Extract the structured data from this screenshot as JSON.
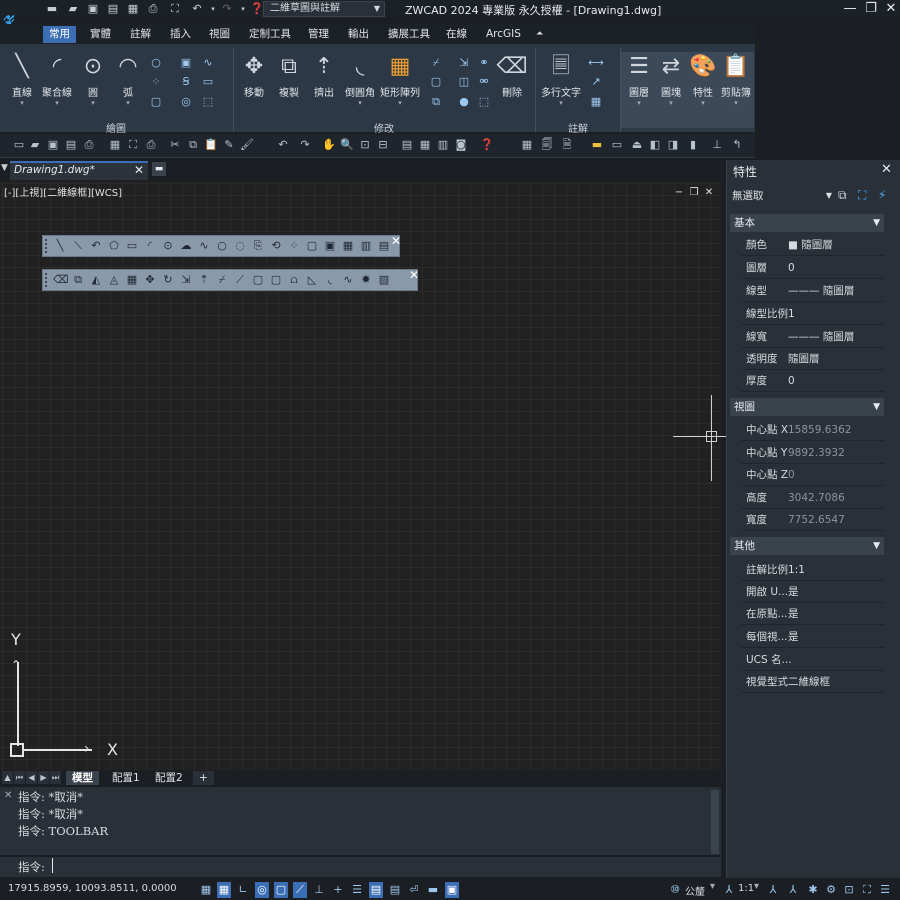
{
  "title_bar": {
    "workspace": "二維草圖與註解",
    "window_title": "ZWCAD 2024 專業版 永久授權 - [Drawing1.dwg]"
  },
  "ribbon_tabs": [
    "常用",
    "實體",
    "註解",
    "插入",
    "視圖",
    "定制工具",
    "管理",
    "輸出",
    "擴展工具",
    "在線",
    "ArcGIS"
  ],
  "ribbon": {
    "draw": {
      "title": "繪圖",
      "line": "直線",
      "polyline": "聚合線",
      "circle": "圓",
      "arc": "弧"
    },
    "modify": {
      "title": "修改",
      "move": "移動",
      "copy": "複製",
      "extrude": "擠出",
      "fillet": "倒圓角",
      "array": "矩形陣列",
      "erase": "刪除"
    },
    "annotation": {
      "title": "註解",
      "mtext": "多行文字"
    },
    "layers": "圖層",
    "blocks": "圖塊",
    "properties": "特性",
    "clipboard": "剪貼簿"
  },
  "document": {
    "tab_name": "Drawing1.dwg*"
  },
  "viewport": {
    "label": "[-][上視][二維線框][WCS]",
    "ucs_x": "X",
    "ucs_y": "Y"
  },
  "layout_tabs": [
    "模型",
    "配置1",
    "配置2",
    "+"
  ],
  "command": {
    "history": [
      "指令: *取消*",
      "指令: *取消*",
      "指令: TOOLBAR"
    ],
    "prompt": "指令:"
  },
  "status": {
    "coords": "17915.8959, 10093.8511, 0.0000",
    "units": "公釐",
    "scale": "1:1"
  },
  "properties": {
    "title": "特性",
    "selection": "無選取",
    "sections": [
      {
        "name": "基本",
        "rows": [
          {
            "key": "顏色",
            "value": "■ 隨圖層"
          },
          {
            "key": "圖層",
            "value": "0"
          },
          {
            "key": "線型",
            "value": "——— 隨圖層"
          },
          {
            "key": "線型比例",
            "value": "1"
          },
          {
            "key": "線寬",
            "value": "——— 隨圖層"
          },
          {
            "key": "透明度",
            "value": "隨圖層"
          },
          {
            "key": "厚度",
            "value": "0"
          }
        ]
      },
      {
        "name": "視圖",
        "rows": [
          {
            "key": "中心點 X",
            "value": "15859.6362"
          },
          {
            "key": "中心點 Y",
            "value": "9892.3932"
          },
          {
            "key": "中心點 Z",
            "value": "0"
          },
          {
            "key": "高度",
            "value": "3042.7086"
          },
          {
            "key": "寬度",
            "value": "7752.6547"
          }
        ]
      },
      {
        "name": "其他",
        "rows": [
          {
            "key": "註解比例",
            "value": "1:1"
          },
          {
            "key": "開啟 U...",
            "value": "是"
          },
          {
            "key": "在原點...",
            "value": "是"
          },
          {
            "key": "每個視...",
            "value": "是"
          },
          {
            "key": "UCS 名...",
            "value": ""
          },
          {
            "key": "視覺型式",
            "value": "二維線框"
          }
        ]
      }
    ]
  },
  "colors": {
    "accent": "#3b6eb4",
    "ribbon": "#2c3846",
    "canvas": "#212121"
  }
}
